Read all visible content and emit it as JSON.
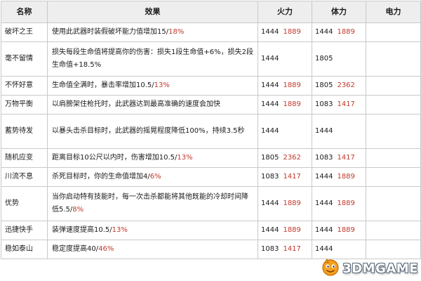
{
  "table": {
    "headers": {
      "name": "名称",
      "effect": "效果",
      "firepower": "火力",
      "stamina": "体力",
      "power": "电力"
    },
    "rows": [
      {
        "name": "破坏之王",
        "effect_text": "使用此武器时装假破坏能力值增加15/",
        "effect_hl": "18%",
        "fire": [
          "1444",
          "1889"
        ],
        "stamina": [
          "1444",
          "1889"
        ],
        "power": ""
      },
      {
        "name": "毫不留情",
        "effect_text": "损失每段生命值将提高你的伤害：损失1段生命值+6%，损失2段生命值+18.5%",
        "effect_hl": "",
        "fire": [
          "1444",
          ""
        ],
        "stamina": [
          "1805",
          ""
        ],
        "power": ""
      },
      {
        "name": "不怀好意",
        "effect_text": "生命值全满时，暴击率增加10.5/",
        "effect_hl": "13%",
        "fire": [
          "1444",
          "1889"
        ],
        "stamina": [
          "1805",
          "2362"
        ],
        "power": ""
      },
      {
        "name": "万物平衡",
        "effect_text": "以肩膀架住枪托时，此武器达到最高准确的速度会加快",
        "effect_hl": "",
        "fire": [
          "1444",
          "1889"
        ],
        "stamina": [
          "1083",
          "1417"
        ],
        "power": ""
      },
      {
        "name": "蓄势待发",
        "effect_text": "以暴头击杀目标时，此武器的摇晃程度降低100%，持续3.5秒",
        "effect_hl": "",
        "fire": [
          "1444",
          ""
        ],
        "stamina": [
          "1444",
          ""
        ],
        "power": ""
      },
      {
        "name": "随机应变",
        "effect_text": "距离目标10公尺以内时，伤害增加10.5/",
        "effect_hl": "13%",
        "fire": [
          "1805",
          "2362"
        ],
        "stamina": [
          "1083",
          "1417"
        ],
        "power": ""
      },
      {
        "name": "川流不息",
        "effect_text": "杀死目标时，你的生命值增加4/",
        "effect_hl": "6%",
        "fire": [
          "1083",
          "1417"
        ],
        "stamina": [
          "1444",
          "1889"
        ],
        "power": ""
      },
      {
        "name": "优势",
        "effect_text": "当你启动特有技能时，每一次击杀都能将其他既能的冷却时间降低5.5/",
        "effect_hl": "8%",
        "fire": [
          "1444",
          "1889"
        ],
        "stamina": [
          "1444",
          "1889"
        ],
        "power": ""
      },
      {
        "name": "迅捷快手",
        "effect_text": "装弹速度提高10.5/",
        "effect_hl": "13%",
        "fire": [
          "1444",
          "1889"
        ],
        "stamina": [
          "1444",
          "1889"
        ],
        "power": ""
      },
      {
        "name": "稳如泰山",
        "effect_text": "稳定度提高40/",
        "effect_hl": "46%",
        "fire": [
          "1083",
          "1417"
        ],
        "stamina": [
          "1444",
          ""
        ],
        "power": ""
      }
    ]
  },
  "watermark": {
    "text": "3DMGAME",
    "icon": "3dm-mascot-icon"
  },
  "colors": {
    "highlight": "#c0392b",
    "header_bg": "#eeeeee",
    "border": "#c9c9c9"
  }
}
